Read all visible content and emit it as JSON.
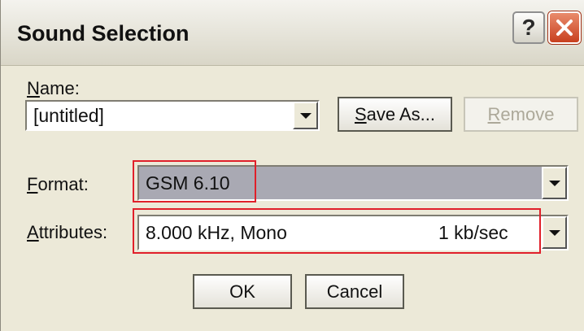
{
  "dialog": {
    "title": "Sound Selection",
    "help_label": "?"
  },
  "name": {
    "label_first": "N",
    "label_rest": "ame:",
    "value": "[untitled]"
  },
  "buttons": {
    "save_as_first": "S",
    "save_as_rest": "ave As...",
    "remove_first": "R",
    "remove_rest": "emove",
    "ok": "OK",
    "cancel": "Cancel"
  },
  "format": {
    "label_first": "F",
    "label_rest": "ormat:",
    "value": "GSM 6.10"
  },
  "attributes": {
    "label_first": "A",
    "label_rest": "ttributes:",
    "value": "8.000 kHz, Mono",
    "rate": "1 kb/sec"
  },
  "colors": {
    "highlight": "#e0202a",
    "format_field_bg": "#a9a9b3",
    "dialog_bg": "#ece9d8"
  },
  "icons": [
    "help-icon",
    "close-icon",
    "dropdown-arrow-icon"
  ]
}
